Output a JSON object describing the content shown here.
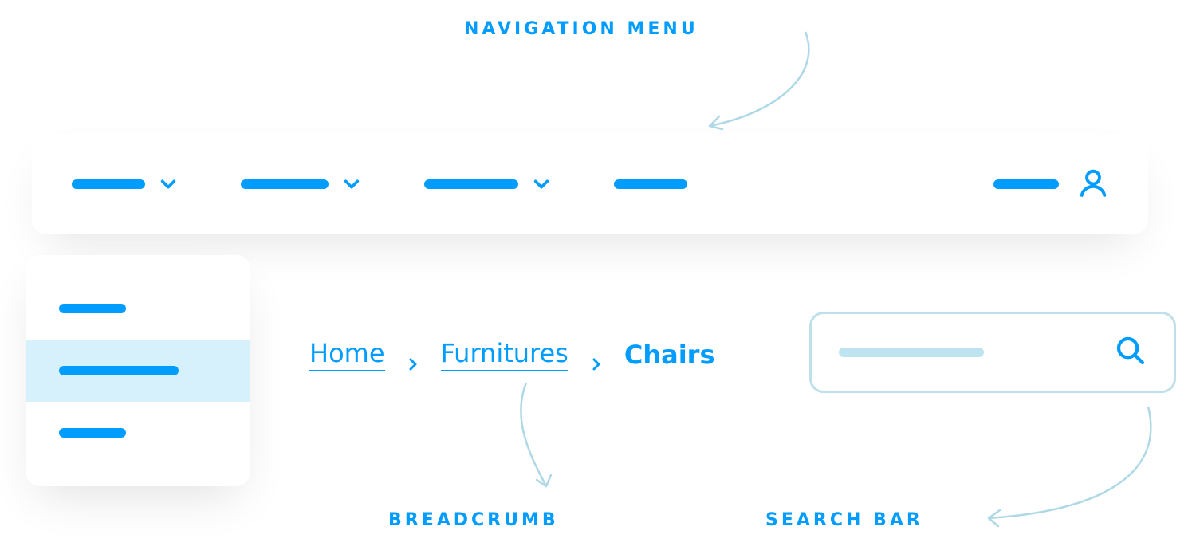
{
  "annotations": {
    "nav_menu": "NAVIGATION MENU",
    "breadcrumb": "BREADCRUMB",
    "search": "SEARCH BAR"
  },
  "breadcrumb": {
    "items": [
      "Home",
      "Furnitures",
      "Chairs"
    ]
  },
  "colors": {
    "blue": "#009dff",
    "arrow": "#aed8e6",
    "search_border": "#bde0ea",
    "dropdown_hover": "#d6f1fb"
  }
}
